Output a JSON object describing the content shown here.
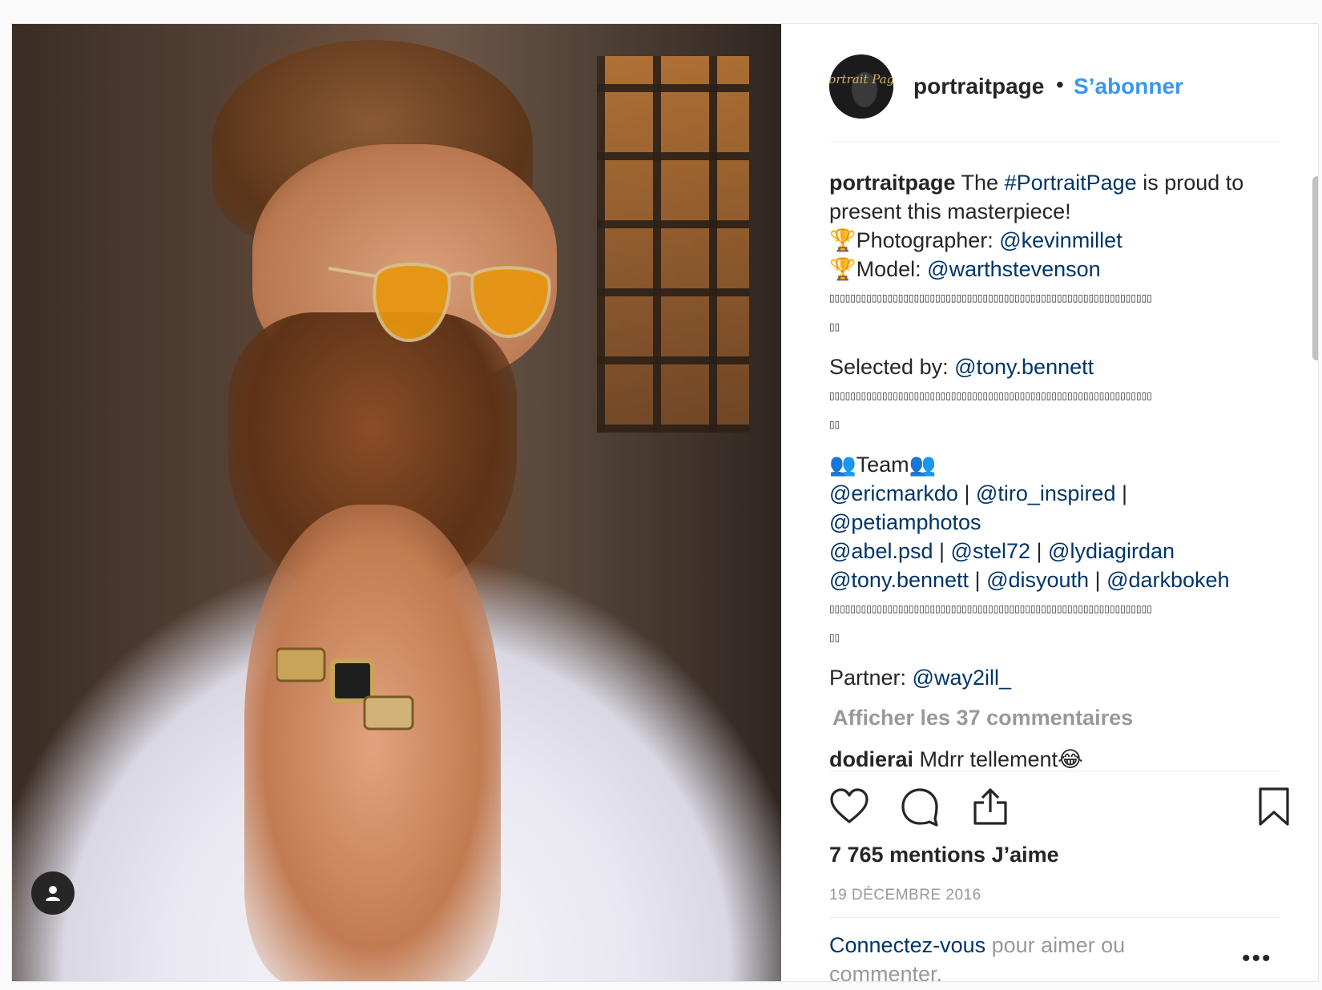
{
  "post": {
    "username": "portraitpage",
    "dot": "•",
    "follow_label": "S’abonner",
    "avatar_text": "Portrait Page"
  },
  "caption": {
    "user": "portraitpage",
    "text_a": " The ",
    "hashtag": "#PortraitPage",
    "text_b": " is proud to present this masterpiece!",
    "trophy": "🏆",
    "photographer_label": "Photographer: ",
    "photographer": "@kevinmillet",
    "model_label": "Model: ",
    "model": "@warthstevenson",
    "boxes_long": "▯▯▯▯▯▯▯▯▯▯▯▯▯▯▯▯▯▯▯▯▯▯▯▯▯▯▯▯▯▯▯▯▯▯▯▯▯▯▯▯▯▯▯▯▯▯▯▯▯▯▯▯▯▯▯▯▯▯▯▯▯",
    "boxes_short": "▯▯",
    "selected_label": "Selected by: ",
    "selected_by": "@tony.bennett",
    "team_icon": "👥",
    "team_label": "Team",
    "team": [
      "@ericmarkdo",
      "@tiro_inspired",
      "@petiamphotos",
      "@abel.psd",
      "@stel72",
      "@lydiagirdan",
      "@tony.bennett",
      "@disyouth",
      "@darkbokeh"
    ],
    "separator": " | ",
    "partner_label": "Partner: ",
    "partner": "@way2ill_"
  },
  "view_all": "Afficher les 37 commentaires",
  "first_comment": {
    "user": "dodierai",
    "text": " Mdrr tellement",
    "emoji": "😂"
  },
  "likes": "7 765 mentions J’aime",
  "date": "19 DÉCEMBRE 2016",
  "login": {
    "link": "Connectez-vous",
    "text": " pour aimer ou commenter."
  },
  "more": "•••",
  "icons": {
    "like": "heart-icon",
    "comment": "comment-icon",
    "share": "share-icon",
    "save": "bookmark-icon",
    "profile": "user-icon"
  }
}
